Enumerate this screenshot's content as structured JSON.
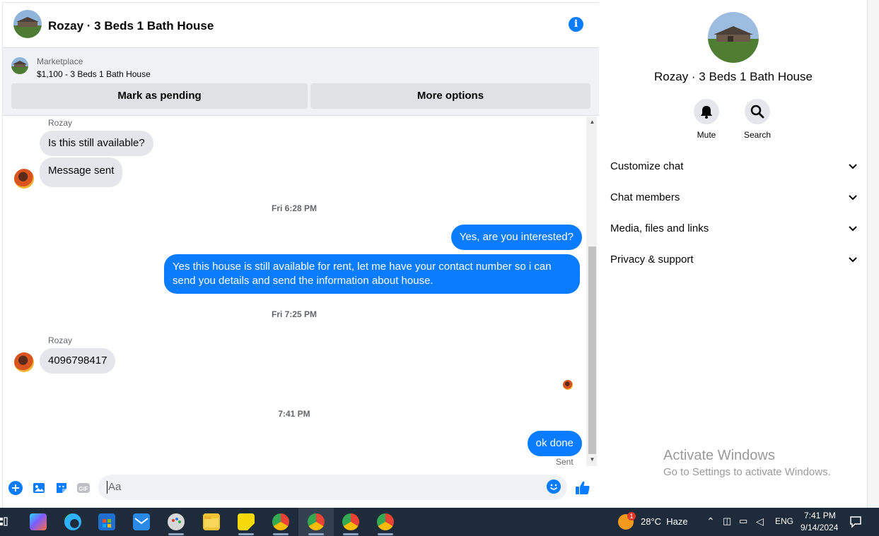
{
  "header": {
    "title": "Rozay · 3 Beds 1 Bath House"
  },
  "marketplace": {
    "label": "Marketplace",
    "listing": "$1,100 - 3 Beds 1 Bath House",
    "pending_button": "Mark as pending",
    "more_button": "More options"
  },
  "thread": {
    "sender_1": "Rozay",
    "msg_1": "Is this still available?",
    "msg_2": "Message sent",
    "time_1": "Fri 6:28 PM",
    "msg_3": "Yes, are you interested?",
    "msg_4": "Yes this house is still available for rent, let me have your contact number so i can send you details and send the information about house.",
    "time_2": "Fri 7:25 PM",
    "sender_2": "Rozay",
    "msg_5": "4096798417",
    "time_3": "7:41 PM",
    "msg_6": "ok done",
    "sent_status": "Sent"
  },
  "composer": {
    "placeholder": "Aa"
  },
  "side": {
    "title": "Rozay · 3 Beds 1 Bath House",
    "mute_label": "Mute",
    "search_label": "Search",
    "rows": [
      "Customize chat",
      "Chat members",
      "Media, files and links",
      "Privacy & support"
    ]
  },
  "watermark": {
    "line1": "Activate Windows",
    "line2": "Go to Settings to activate Windows."
  },
  "taskbar": {
    "weather_badge": "1",
    "weather": "28°C  Haze",
    "language": "ENG",
    "time": "7:41 PM",
    "date": "9/14/2024"
  },
  "colors": {
    "accent": "#0a7cff",
    "incoming_bubble": "#e4e6eb",
    "panel_bg": "#f0f2f5",
    "taskbar": "#1e2b3a"
  }
}
